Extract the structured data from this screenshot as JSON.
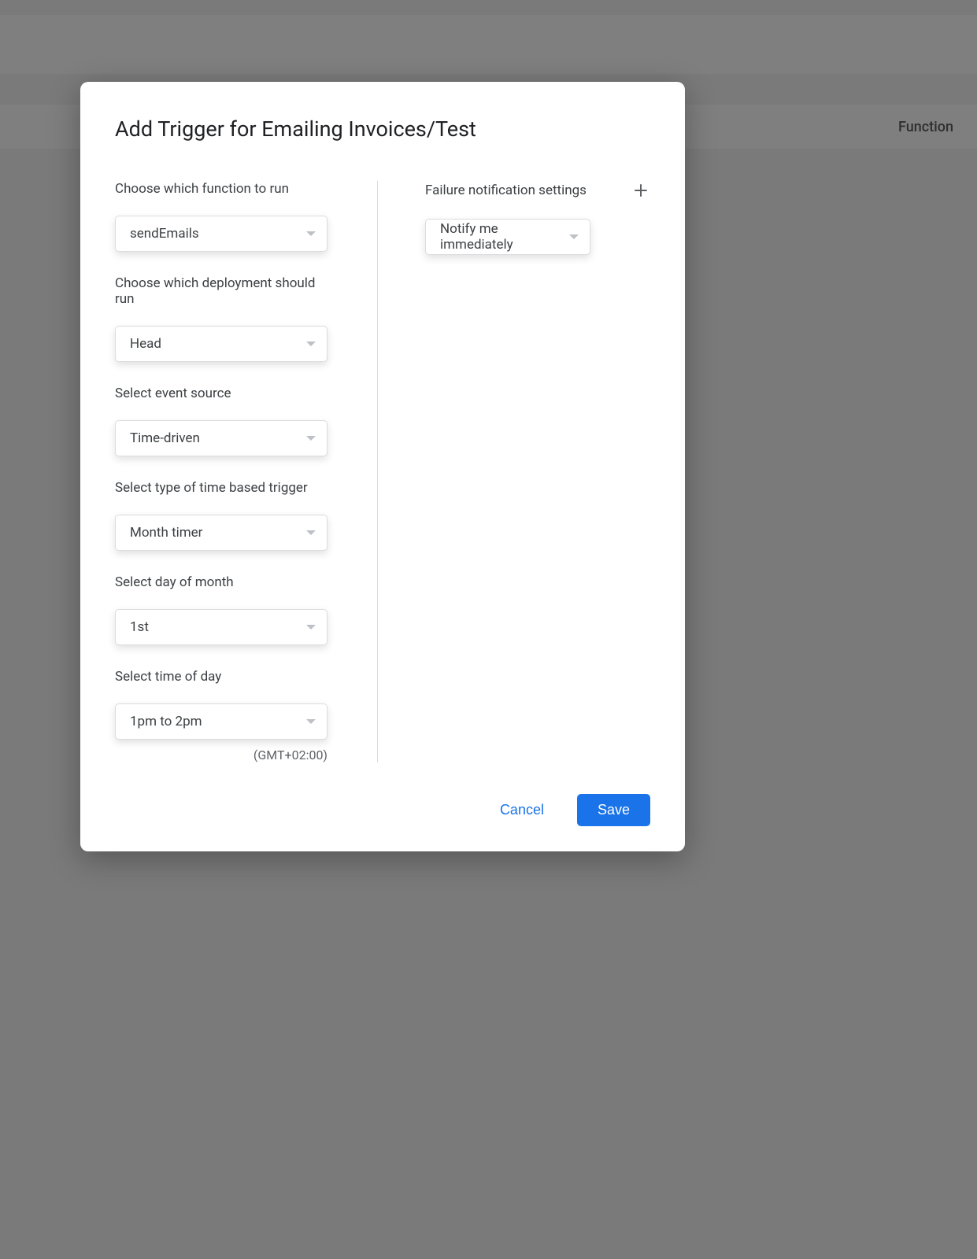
{
  "background": {
    "function_label": "Function"
  },
  "modal": {
    "title": "Add Trigger for Emailing Invoices/Test",
    "left": {
      "function": {
        "label": "Choose which function to run",
        "value": "sendEmails"
      },
      "deployment": {
        "label": "Choose which deployment should run",
        "value": "Head"
      },
      "event_source": {
        "label": "Select event source",
        "value": "Time-driven"
      },
      "trigger_type": {
        "label": "Select type of time based trigger",
        "value": "Month timer"
      },
      "day_of_month": {
        "label": "Select day of month",
        "value": "1st"
      },
      "time_of_day": {
        "label": "Select time of day",
        "value": "1pm to 2pm",
        "tz": "(GMT+02:00)"
      }
    },
    "right": {
      "failure": {
        "label": "Failure notification settings",
        "value": "Notify me immediately"
      }
    },
    "footer": {
      "cancel": "Cancel",
      "save": "Save"
    }
  }
}
